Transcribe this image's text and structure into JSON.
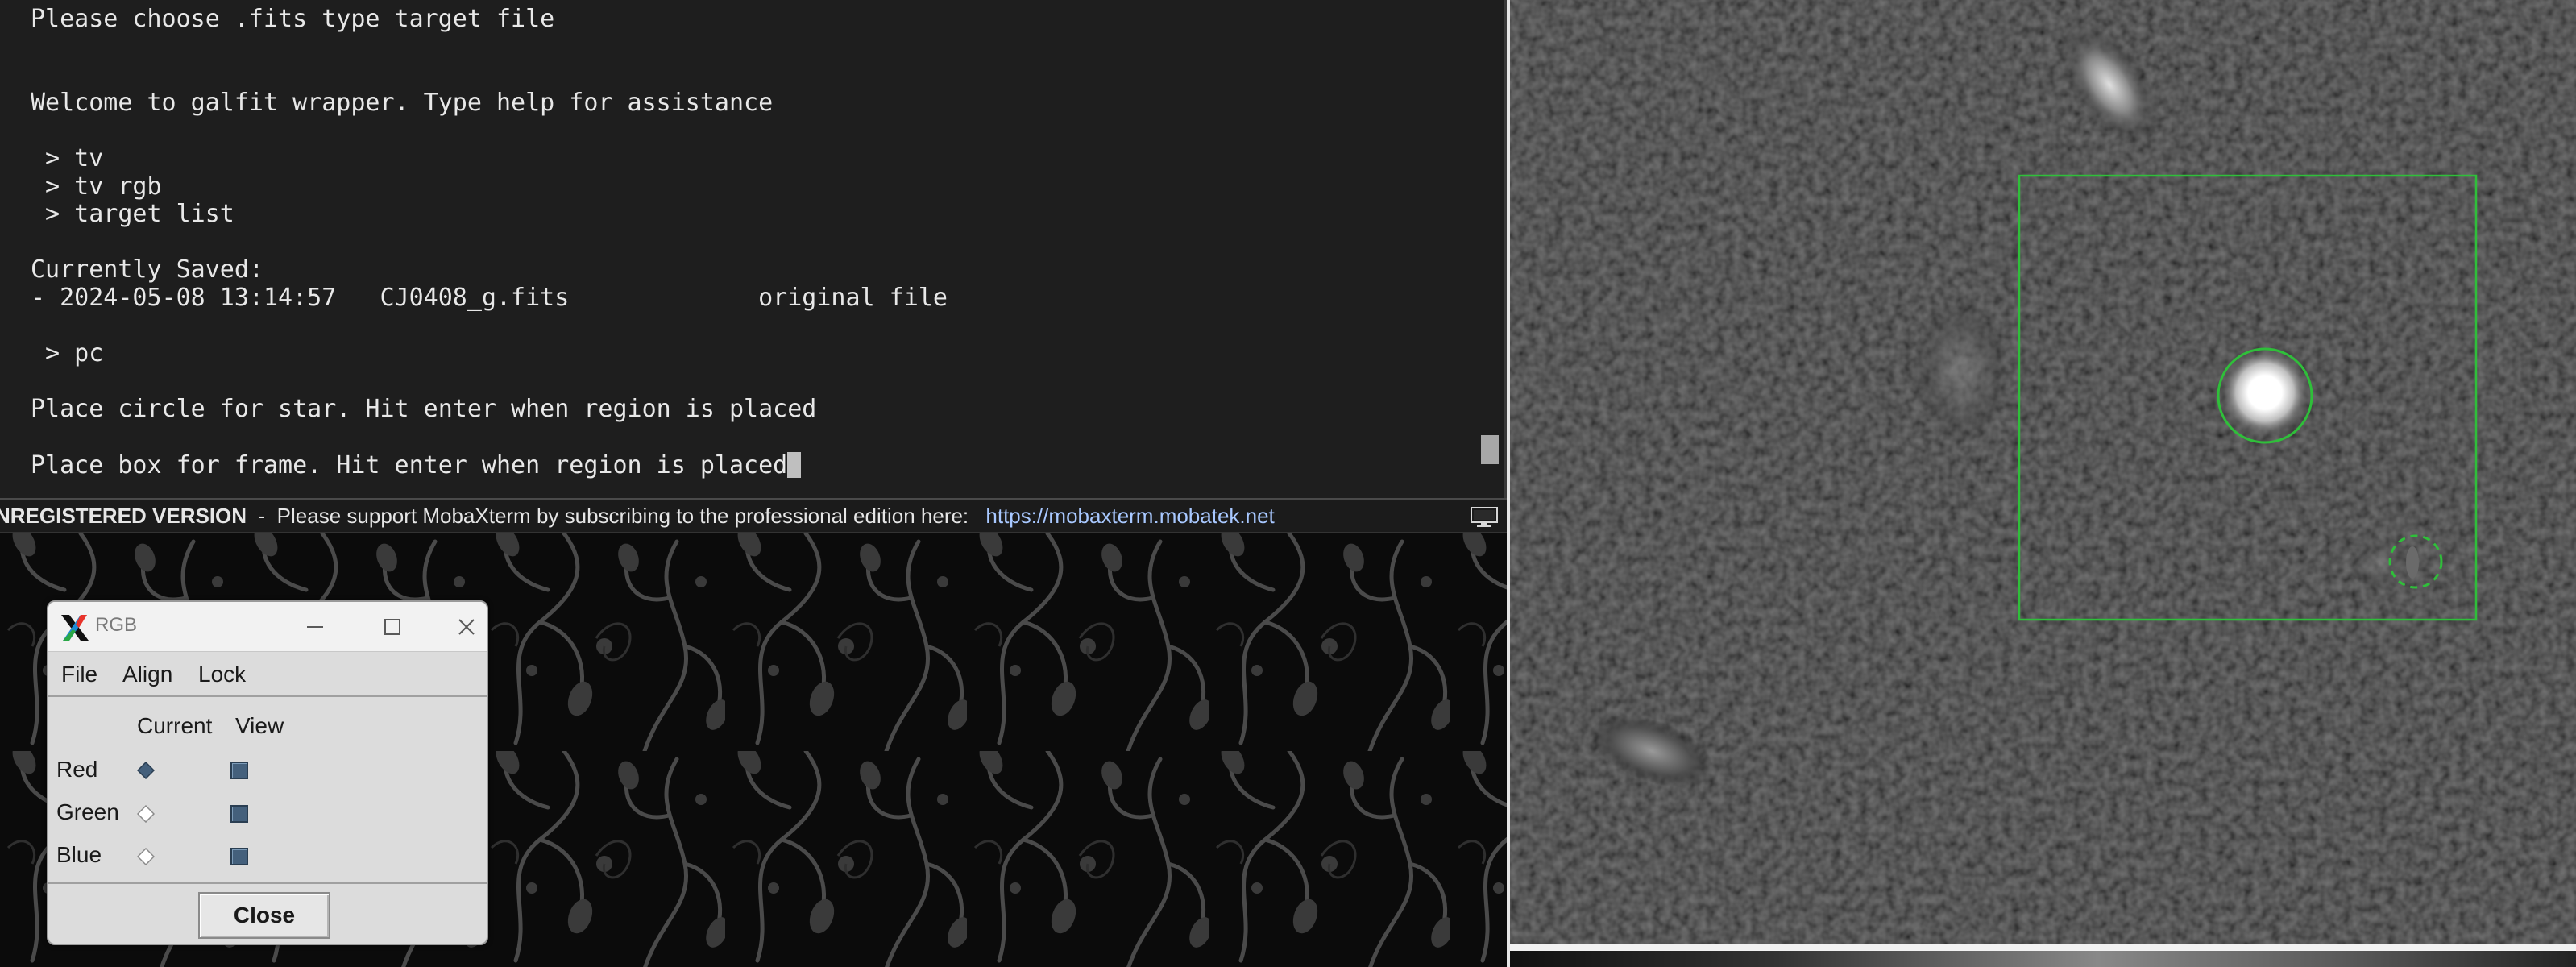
{
  "terminal": {
    "lines": [
      "Please choose .fits type target file",
      "",
      "",
      "Welcome to galfit wrapper. Type help for assistance",
      "",
      " > tv",
      " > tv rgb",
      " > target list",
      "",
      "Currently Saved:",
      "- 2024-05-08 13:14:57   CJ0408_g.fits             original file",
      "",
      " > pc",
      "",
      "Place circle for star. Hit enter when region is placed",
      "",
      "Place box for frame. Hit enter when region is placed"
    ]
  },
  "statusbar": {
    "unregistered": "NREGISTERED VERSION",
    "separator": "-",
    "message": "Please support MobaXterm by subscribing to the professional edition here:",
    "link": "https://mobaxterm.mobatek.net",
    "monitor_icon": "monitor-icon"
  },
  "rgb_window": {
    "title": "RGB",
    "menu": {
      "file": "File",
      "align": "Align",
      "lock": "Lock"
    },
    "headers": {
      "current": "Current",
      "view": "View"
    },
    "channels": [
      {
        "label": "Red",
        "current_selected": true,
        "view_checked": true
      },
      {
        "label": "Green",
        "current_selected": false,
        "view_checked": true
      },
      {
        "label": "Blue",
        "current_selected": false,
        "view_checked": true
      }
    ],
    "close_label": "Close"
  },
  "viewer": {
    "region_color": "#2fbf3a"
  }
}
